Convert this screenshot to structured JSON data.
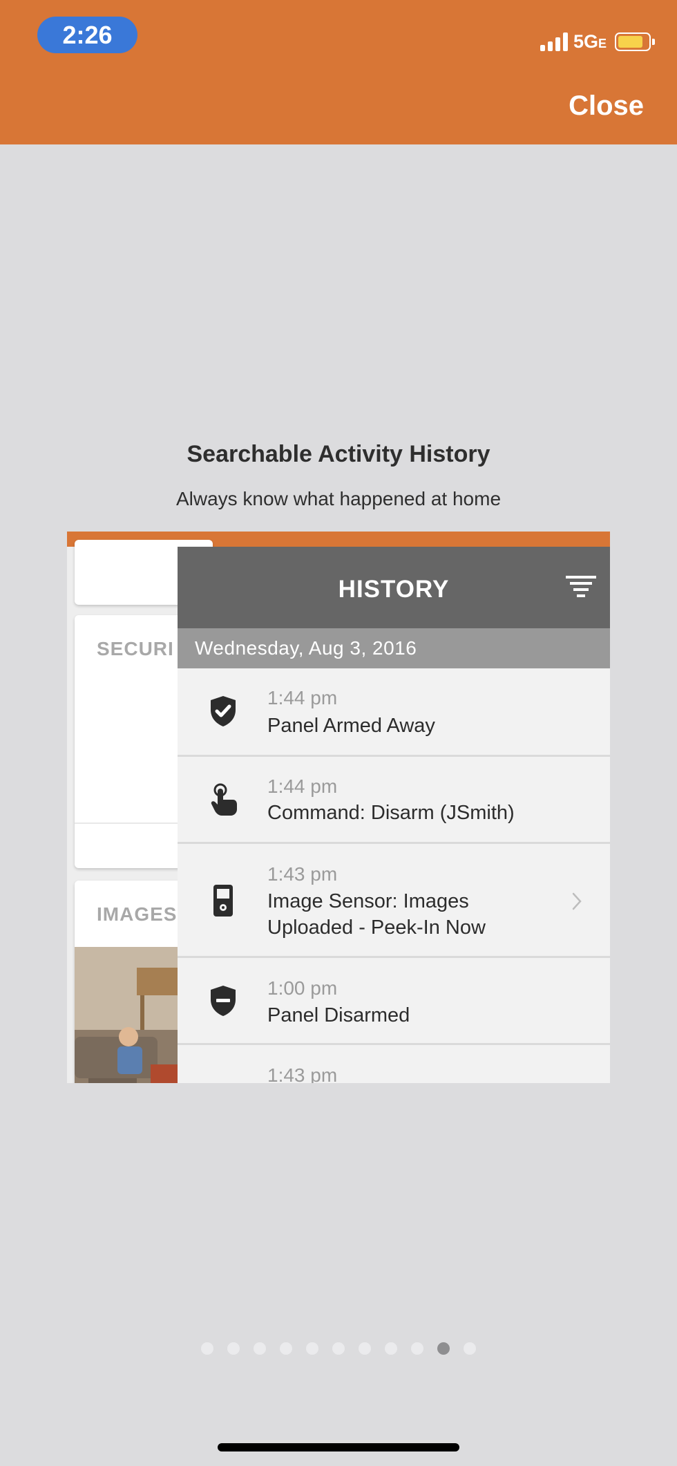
{
  "status_bar": {
    "time": "2:26",
    "network": "5G",
    "network_suffix": "E",
    "battery_color": "#F7D24B"
  },
  "header": {
    "close_label": "Close",
    "background_color": "#D87636"
  },
  "feature": {
    "title": "Searchable Activity History",
    "subtitle": "Always know what happened at home"
  },
  "promo": {
    "cards": {
      "security_label": "SECURI",
      "images_label": "IMAGES"
    },
    "history": {
      "title": "HISTORY",
      "date": "Wednesday, Aug 3, 2016",
      "events": [
        {
          "time": "1:44 pm",
          "text": "Panel Armed Away",
          "icon": "shield-check-icon"
        },
        {
          "time": "1:44 pm",
          "text": "Command: Disarm (JSmith)",
          "icon": "touch-hand-icon"
        },
        {
          "time": "1:43 pm",
          "text": "Image Sensor: Images Uploaded - Peek-In Now",
          "icon": "image-sensor-icon"
        },
        {
          "time": "1:00 pm",
          "text": "Panel Disarmed",
          "icon": "shield-minus-icon"
        },
        {
          "time": "1:43 pm",
          "text": "",
          "icon": ""
        }
      ]
    }
  },
  "pagination": {
    "total_pages": 11,
    "active_page": 10
  }
}
